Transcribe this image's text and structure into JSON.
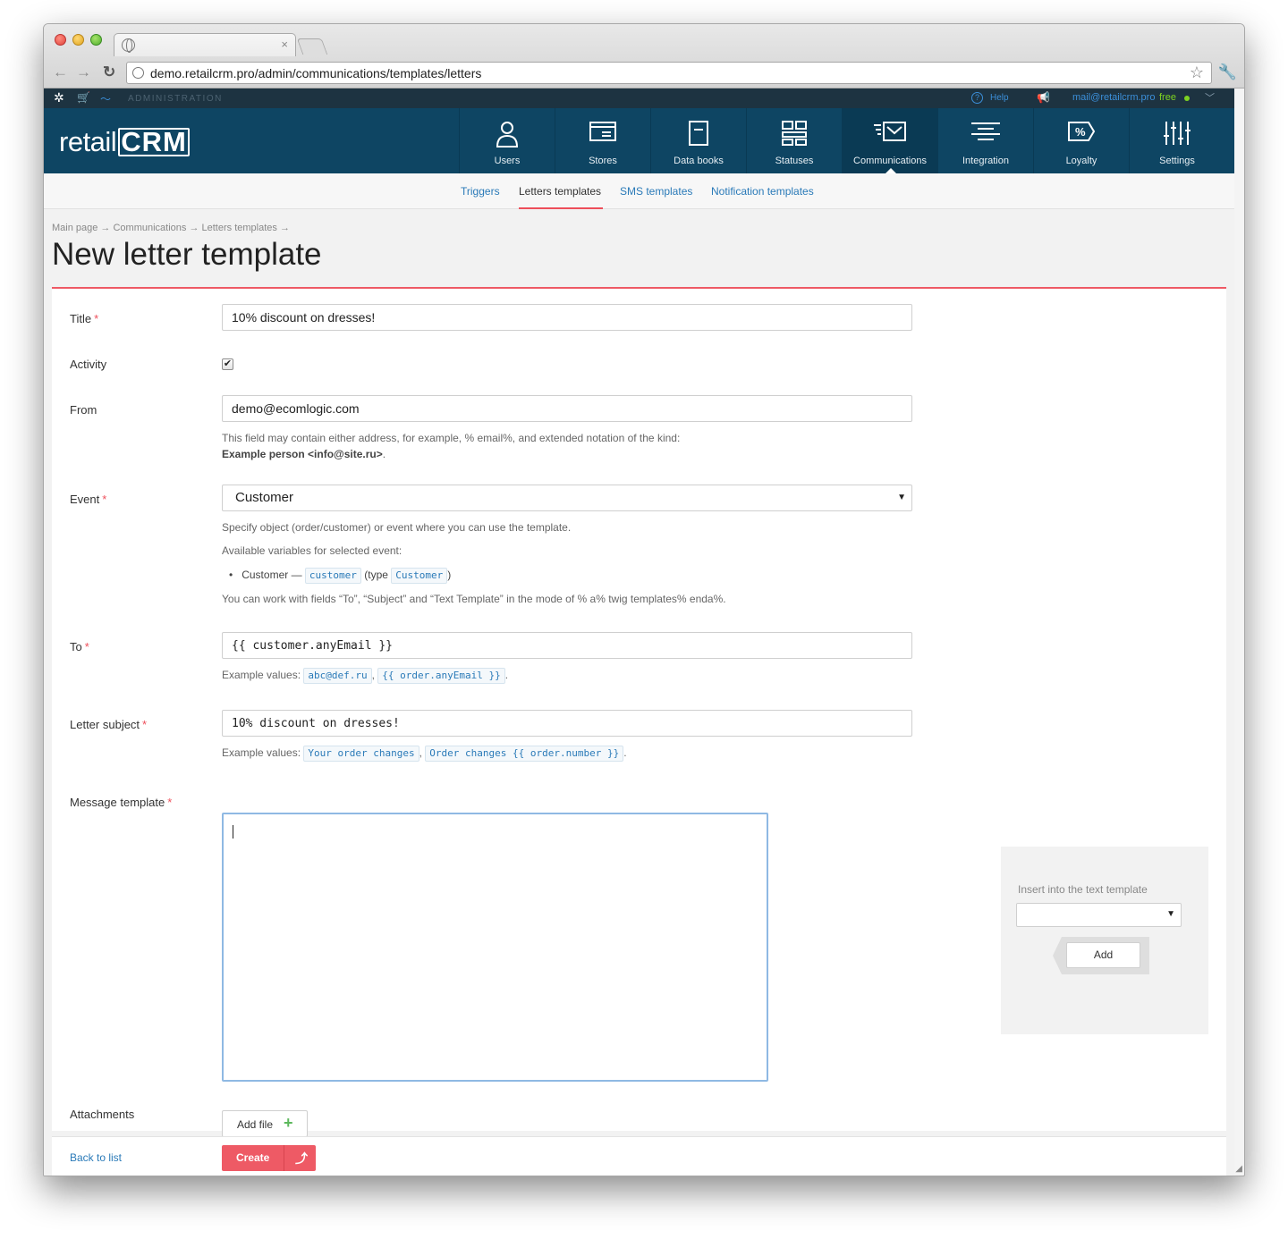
{
  "browser": {
    "url": "demo.retailcrm.pro/admin/communications/templates/letters",
    "tab_close": "×"
  },
  "admin_bar": {
    "label": "ADMINISTRATION",
    "help": "Help",
    "email": "mail@retailcrm.pro",
    "plan": "free"
  },
  "logo": {
    "prefix": "retail",
    "suffix": "CRM"
  },
  "nav": {
    "items": [
      {
        "label": "Users",
        "icon": "user-icon"
      },
      {
        "label": "Stores",
        "icon": "store-icon"
      },
      {
        "label": "Data books",
        "icon": "databook-icon"
      },
      {
        "label": "Statuses",
        "icon": "statuses-icon"
      },
      {
        "label": "Communications",
        "icon": "communications-icon",
        "active": true
      },
      {
        "label": "Integration",
        "icon": "integration-icon"
      },
      {
        "label": "Loyalty",
        "icon": "loyalty-icon"
      },
      {
        "label": "Settings",
        "icon": "settings-icon"
      }
    ]
  },
  "subnav": {
    "items": [
      "Triggers",
      "Letters templates",
      "SMS templates",
      "Notification templates"
    ],
    "active": "Letters templates"
  },
  "breadcrumb": "Main page → Communications → Letters templates →",
  "page_title": "New letter template",
  "form": {
    "title_label": "Title",
    "title_value": "10% discount on dresses!",
    "activity_label": "Activity",
    "activity_checked": true,
    "from_label": "From",
    "from_value": "demo@ecomlogic.com",
    "from_help_line1": "This field may contain either address, for example, % email%, and extended notation of the kind:",
    "from_help_line2": "Example person <info@site.ru>",
    "from_help_end": ".",
    "event_label": "Event",
    "event_value": "Customer",
    "event_help1": "Specify object (order/customer) or event where you can use the template.",
    "event_help2": "Available variables for selected event:",
    "event_var_name": "Customer —",
    "event_var_code": "customer",
    "event_var_type_pre": "(type",
    "event_var_type": "Customer",
    "event_var_type_post": ")",
    "event_help3": "You can work with fields “To”, “Subject” and “Text Template” in the mode of % a% twig templates% enda%.",
    "to_label": "To",
    "to_value": "{{ customer.anyEmail }}",
    "to_example_pre": "Example values:",
    "to_example1": "abc@def.ru",
    "to_example2": "{{ order.anyEmail }}",
    "subject_label": "Letter subject",
    "subject_value": "10% discount on dresses!",
    "subject_example_pre": "Example values:",
    "subject_example1": "Your order changes",
    "subject_example2": "Order changes {{ order.number }}",
    "message_label": "Message template",
    "attachments_label": "Attachments",
    "add_file": "Add file"
  },
  "insert_panel": {
    "label": "Insert into the text template",
    "add": "Add"
  },
  "footer": {
    "back": "Back to list",
    "create": "Create"
  },
  "colors": {
    "header": "#0e4563",
    "admin_bar": "#1d3341",
    "accent": "#ee5a65",
    "link": "#2a7ab8"
  }
}
